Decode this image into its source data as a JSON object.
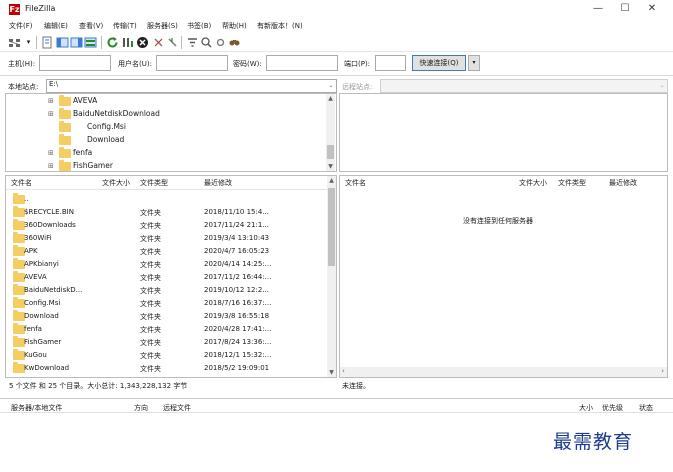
{
  "window": {
    "title": "FileZilla",
    "app_icon_glyph": "Fz",
    "controls": {
      "minimize": "—",
      "maximize": "☐",
      "close": "✕"
    }
  },
  "menu": [
    "文件(F)",
    "编辑(E)",
    "查看(V)",
    "传输(T)",
    "服务器(S)",
    "书签(B)",
    "帮助(H)",
    "有新版本！(N)"
  ],
  "toolbar_icons": [
    "site-manager-icon",
    "dropdown-icon",
    "toggle-log-icon",
    "toggle-local-tree-icon",
    "toggle-remote-tree-icon",
    "toggle-queue-icon",
    "refresh-icon",
    "process-queue-icon",
    "cancel-icon",
    "disconnect-icon",
    "reconnect-icon",
    "filter-icon",
    "compare-icon",
    "sync-browse-icon",
    "search-icon"
  ],
  "quickconnect": {
    "host_label": "主机(H):",
    "host_value": "",
    "user_label": "用户名(U):",
    "user_value": "",
    "pass_label": "密码(W):",
    "pass_value": "",
    "port_label": "端口(P):",
    "port_value": "",
    "button": "快速连接(Q)",
    "dropdown": "▾"
  },
  "local": {
    "site_label": "本地站点:",
    "site_path": "E:\\",
    "tree": [
      {
        "name": "AVEVA",
        "expandable": true
      },
      {
        "name": "BaiduNetdiskDownload",
        "expandable": true
      },
      {
        "name": "Config.Msi",
        "expandable": false
      },
      {
        "name": "Download",
        "expandable": false
      },
      {
        "name": "fenfa",
        "expandable": true
      },
      {
        "name": "FishGamer",
        "expandable": true
      }
    ],
    "columns": {
      "name": "文件名",
      "size": "文件大小",
      "type": "文件类型",
      "modified": "最近修改"
    },
    "files": [
      {
        "name": "..",
        "type": "",
        "modified": ""
      },
      {
        "name": "$RECYCLE.BIN",
        "type": "文件夹",
        "modified": "2018/11/10 15:4..."
      },
      {
        "name": "360Downloads",
        "type": "文件夹",
        "modified": "2017/11/24 21:1..."
      },
      {
        "name": "360WiFi",
        "type": "文件夹",
        "modified": "2019/3/4 13:10:43"
      },
      {
        "name": "APK",
        "type": "文件夹",
        "modified": "2020/4/7 16:05:23"
      },
      {
        "name": "APKbianyi",
        "type": "文件夹",
        "modified": "2020/4/14 14:25:..."
      },
      {
        "name": "AVEVA",
        "type": "文件夹",
        "modified": "2017/11/2 16:44:..."
      },
      {
        "name": "BaiduNetdiskD...",
        "type": "文件夹",
        "modified": "2019/10/12 12:2..."
      },
      {
        "name": "Config.Msi",
        "type": "文件夹",
        "modified": "2018/7/16 16:37:..."
      },
      {
        "name": "Download",
        "type": "文件夹",
        "modified": "2019/3/8 16:55:18"
      },
      {
        "name": "fenfa",
        "type": "文件夹",
        "modified": "2020/4/28 17:41:..."
      },
      {
        "name": "FishGamer",
        "type": "文件夹",
        "modified": "2017/8/24 13:36:..."
      },
      {
        "name": "KuGou",
        "type": "文件夹",
        "modified": "2018/12/1 15:32:..."
      },
      {
        "name": "KwDownload",
        "type": "文件夹",
        "modified": "2018/5/2 19:09:01"
      }
    ],
    "status": "5 个文件 和 25 个目录。大小总计: 1,343,228,132 字节"
  },
  "remote": {
    "site_label": "远程站点:",
    "site_path": "",
    "columns": {
      "name": "文件名",
      "size": "文件大小",
      "type": "文件类型",
      "modified": "最近修改"
    },
    "empty_message": "没有连接到任何服务器",
    "status": "未连接。"
  },
  "queue": {
    "server_file": "服务器/本地文件",
    "direction": "方向",
    "remote_file": "远程文件",
    "size": "大小",
    "priority": "优先级",
    "state": "状态"
  },
  "watermark": "最需教育",
  "colors": {
    "folder": "#f5cd62",
    "accent": "#3c7fb1",
    "watermark": "#1d3c8f",
    "app_icon": "#bf0000"
  }
}
